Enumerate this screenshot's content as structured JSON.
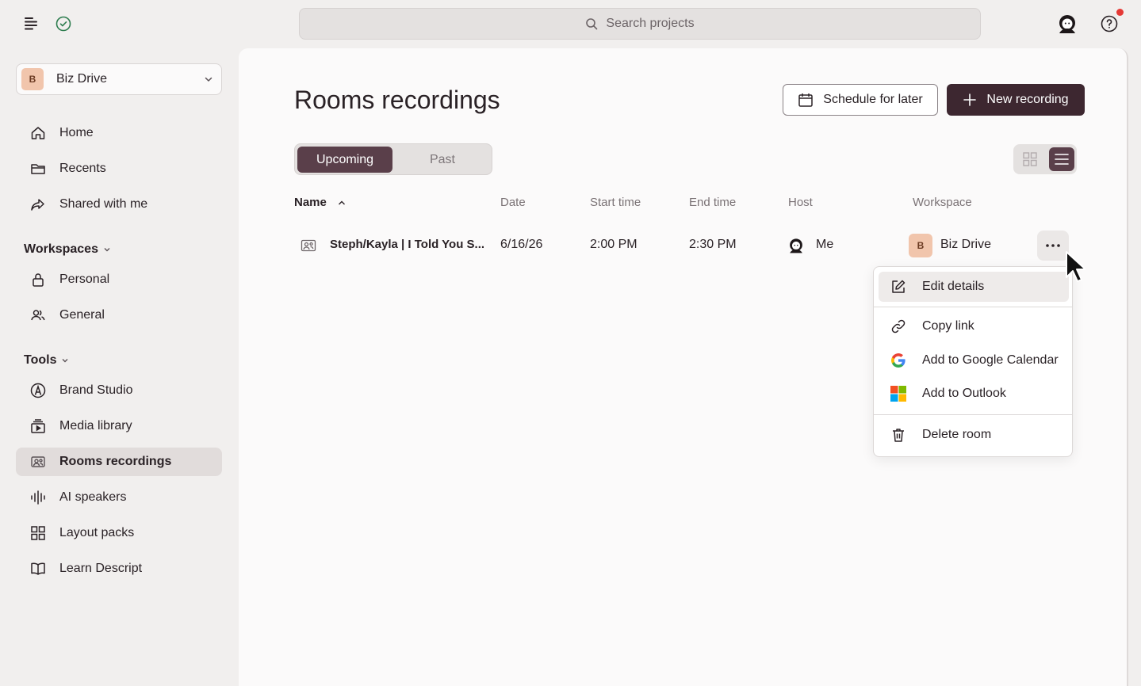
{
  "topbar": {
    "search_placeholder": "Search projects"
  },
  "sidebar": {
    "workspace": {
      "badge": "B",
      "name": "Biz Drive"
    },
    "nav": [
      {
        "label": "Home",
        "icon": "home-icon"
      },
      {
        "label": "Recents",
        "icon": "folder-icon"
      },
      {
        "label": "Shared with me",
        "icon": "share-icon"
      }
    ],
    "workspaces_label": "Workspaces",
    "workspaces": [
      {
        "label": "Personal",
        "icon": "lock-icon"
      },
      {
        "label": "General",
        "icon": "users-icon"
      }
    ],
    "tools_label": "Tools",
    "tools": [
      {
        "label": "Brand Studio",
        "icon": "brand-studio-icon"
      },
      {
        "label": "Media library",
        "icon": "media-library-icon"
      },
      {
        "label": "Rooms recordings",
        "icon": "rooms-icon",
        "active": true
      },
      {
        "label": "AI speakers",
        "icon": "waveform-icon"
      },
      {
        "label": "Layout packs",
        "icon": "layout-grid-icon"
      },
      {
        "label": "Learn Descript",
        "icon": "book-icon"
      }
    ]
  },
  "main": {
    "title": "Rooms recordings",
    "schedule_label": "Schedule for later",
    "new_recording_label": "New recording",
    "tabs": [
      {
        "label": "Upcoming",
        "selected": true
      },
      {
        "label": "Past",
        "selected": false
      }
    ],
    "table": {
      "columns": [
        "Name",
        "Date",
        "Start time",
        "End time",
        "Host",
        "Workspace"
      ],
      "rows": [
        {
          "name": "Steph/Kayla | I Told You S...",
          "date": "6/16/26",
          "start": "2:00 PM",
          "end": "2:30 PM",
          "host": "Me",
          "workspace_badge": "B",
          "workspace": "Biz Drive"
        }
      ]
    }
  },
  "context_menu": {
    "items": [
      {
        "label": "Edit details",
        "icon": "edit-icon"
      },
      {
        "label": "Copy link",
        "icon": "link-icon"
      },
      {
        "label": "Add to Google Calendar",
        "icon": "google-icon"
      },
      {
        "label": "Add to Outlook",
        "icon": "microsoft-icon"
      },
      {
        "label": "Delete room",
        "icon": "trash-icon"
      }
    ]
  },
  "colors": {
    "primary": "#3d2730",
    "segment_active": "#5a3f4a",
    "badge_bg": "#f1c5ac",
    "notification_dot": "#e53935"
  }
}
